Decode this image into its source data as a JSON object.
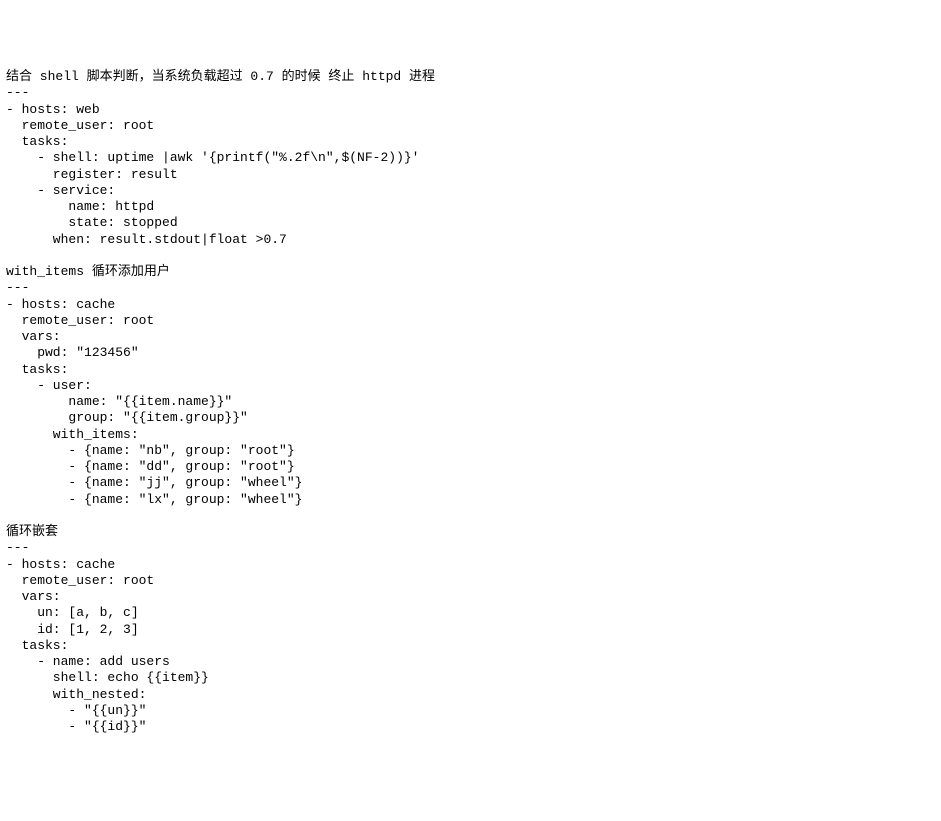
{
  "sections": {
    "s1": {
      "title": "结合 shell 脚本判断，当系统负载超过 0.7 的时候 终止 httpd 进程",
      "sep": "---",
      "lines": [
        "- hosts: web",
        "  remote_user: root",
        "  tasks:",
        "    - shell: uptime |awk '{printf(\"%.2f\\n\",$(NF-2))}'",
        "      register: result",
        "    - service:",
        "        name: httpd",
        "        state: stopped",
        "      when: result.stdout|float >0.7"
      ]
    },
    "s2": {
      "title": "with_items 循环添加用户",
      "sep": "---",
      "lines": [
        "- hosts: cache",
        "  remote_user: root",
        "  vars:",
        "    pwd: \"123456\"",
        "  tasks:",
        "    - user:",
        "        name: \"{{item.name}}\"",
        "        group: \"{{item.group}}\"",
        "      with_items:",
        "        - {name: \"nb\", group: \"root\"}",
        "        - {name: \"dd\", group: \"root\"}",
        "        - {name: \"jj\", group: \"wheel\"}",
        "        - {name: \"lx\", group: \"wheel\"}"
      ]
    },
    "s3": {
      "title": "循环嵌套",
      "sep": "---",
      "lines": [
        "- hosts: cache",
        "  remote_user: root",
        "  vars:",
        "    un: [a, b, c]",
        "    id: [1, 2, 3]",
        "  tasks:",
        "    - name: add users",
        "      shell: echo {{item}}",
        "      with_nested:",
        "        - \"{{un}}\"",
        "        - \"{{id}}\""
      ]
    }
  }
}
